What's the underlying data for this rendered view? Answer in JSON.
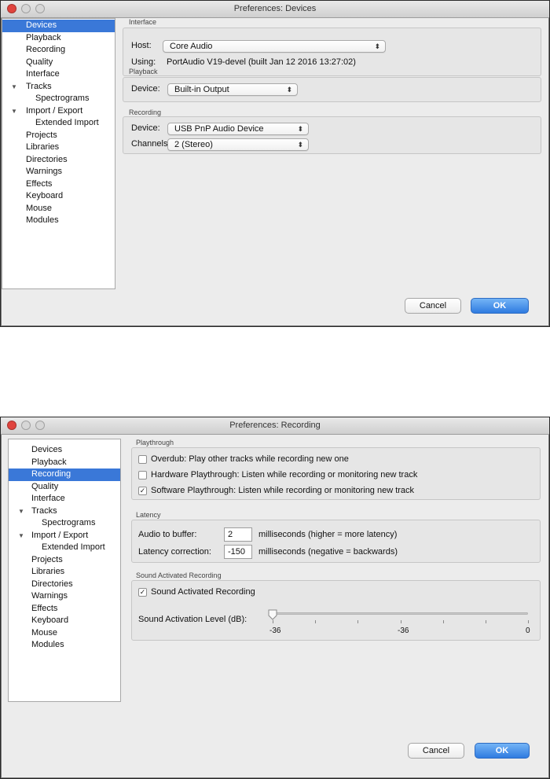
{
  "colors": {
    "selection": "#3a78d8",
    "ok_button": "#2f7be0",
    "close_button": "#e0443e"
  },
  "window1": {
    "title": "Preferences: Devices",
    "sidebar": {
      "selected_index": 0,
      "items": [
        {
          "label": "Devices",
          "level": 0
        },
        {
          "label": "Playback",
          "level": 0
        },
        {
          "label": "Recording",
          "level": 0
        },
        {
          "label": "Quality",
          "level": 0
        },
        {
          "label": "Interface",
          "level": 0
        },
        {
          "label": "Tracks",
          "level": 0,
          "disclosure": "▼"
        },
        {
          "label": "Spectrograms",
          "level": 1
        },
        {
          "label": "Import / Export",
          "level": 0,
          "disclosure": "▼"
        },
        {
          "label": "Extended Import",
          "level": 1
        },
        {
          "label": "Projects",
          "level": 0
        },
        {
          "label": "Libraries",
          "level": 0
        },
        {
          "label": "Directories",
          "level": 0
        },
        {
          "label": "Warnings",
          "level": 0
        },
        {
          "label": "Effects",
          "level": 0
        },
        {
          "label": "Keyboard",
          "level": 0
        },
        {
          "label": "Mouse",
          "level": 0
        },
        {
          "label": "Modules",
          "level": 0
        }
      ]
    },
    "interface": {
      "title": "Interface",
      "host_label": "Host:",
      "host_value": "Core Audio",
      "using_label": "Using:",
      "using_value": "PortAudio V19-devel (built Jan 12 2016 13:27:02)"
    },
    "playback": {
      "title": "Playback",
      "device_label": "Device:",
      "device_value": "Built-in Output"
    },
    "recording": {
      "title": "Recording",
      "device_label": "Device:",
      "device_value": "USB PnP Audio Device",
      "channels_label": "Channels:",
      "channels_value": "2 (Stereo)"
    },
    "buttons": {
      "cancel": "Cancel",
      "ok": "OK"
    }
  },
  "window2": {
    "title": "Preferences: Recording",
    "sidebar": {
      "selected_index": 2,
      "items": [
        {
          "label": "Devices",
          "level": 0
        },
        {
          "label": "Playback",
          "level": 0
        },
        {
          "label": "Recording",
          "level": 0
        },
        {
          "label": "Quality",
          "level": 0
        },
        {
          "label": "Interface",
          "level": 0
        },
        {
          "label": "Tracks",
          "level": 0,
          "disclosure": "▼"
        },
        {
          "label": "Spectrograms",
          "level": 1
        },
        {
          "label": "Import / Export",
          "level": 0,
          "disclosure": "▼"
        },
        {
          "label": "Extended Import",
          "level": 1
        },
        {
          "label": "Projects",
          "level": 0
        },
        {
          "label": "Libraries",
          "level": 0
        },
        {
          "label": "Directories",
          "level": 0
        },
        {
          "label": "Warnings",
          "level": 0
        },
        {
          "label": "Effects",
          "level": 0
        },
        {
          "label": "Keyboard",
          "level": 0
        },
        {
          "label": "Mouse",
          "level": 0
        },
        {
          "label": "Modules",
          "level": 0
        }
      ]
    },
    "playthrough": {
      "title": "Playthrough",
      "overdub": {
        "label": "Overdub: Play other tracks while recording new one",
        "checked": false
      },
      "hardware": {
        "label": "Hardware Playthrough: Listen while recording or monitoring new track",
        "checked": false
      },
      "software": {
        "label": "Software Playthrough: Listen while recording or monitoring new track",
        "checked": true
      }
    },
    "latency": {
      "title": "Latency",
      "buffer_label": "Audio to buffer:",
      "buffer_value": "2",
      "buffer_unit": "milliseconds (higher = more latency)",
      "correction_label": "Latency correction:",
      "correction_value": "-150",
      "correction_unit": "milliseconds (negative = backwards)"
    },
    "sound_activated": {
      "title": "Sound Activated Recording",
      "checkbox_label": "Sound Activated Recording",
      "checked": true,
      "level_label": "Sound Activation Level (dB):",
      "level_value": -36,
      "scale_min_label": "-36",
      "scale_mid_label": "-36",
      "scale_max_label": "0"
    },
    "buttons": {
      "cancel": "Cancel",
      "ok": "OK"
    }
  }
}
